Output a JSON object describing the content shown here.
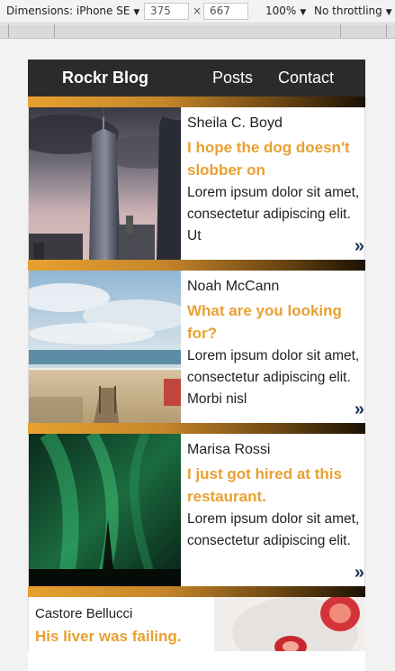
{
  "devtools": {
    "device": "Dimensions: iPhone SE",
    "width": "375",
    "times": "×",
    "height": "667",
    "zoom": "100%",
    "throttling": "No throttling"
  },
  "nav": {
    "brand": "Rockr Blog",
    "links": [
      "Posts",
      "Contact"
    ]
  },
  "posts": [
    {
      "author": "Sheila C. Boyd",
      "title": "I hope the dog doesn't slobber on",
      "excerpt": "Lorem ipsum dolor sit amet, consectetur adipiscing elit. Ut",
      "image": "city-skyscraper",
      "more": "»"
    },
    {
      "author": "Noah McCann",
      "title": "What are you looking for?",
      "excerpt": "Lorem ipsum dolor sit amet, consectetur adipiscing elit. Morbi nisl",
      "image": "beach-boardwalk",
      "more": "»"
    },
    {
      "author": "Marisa Rossi",
      "title": "I just got hired at this restaurant.",
      "excerpt": "Lorem ipsum dolor sit amet, consectetur adipiscing elit.",
      "image": "aurora-night",
      "more": "»"
    },
    {
      "author": "Castore Bellucci",
      "title": "His liver was failing.",
      "image": "strawberries"
    }
  ],
  "colors": {
    "accent": "#e8a032",
    "nav_bg": "#2b2b2b",
    "more_icon": "#1d3557"
  }
}
